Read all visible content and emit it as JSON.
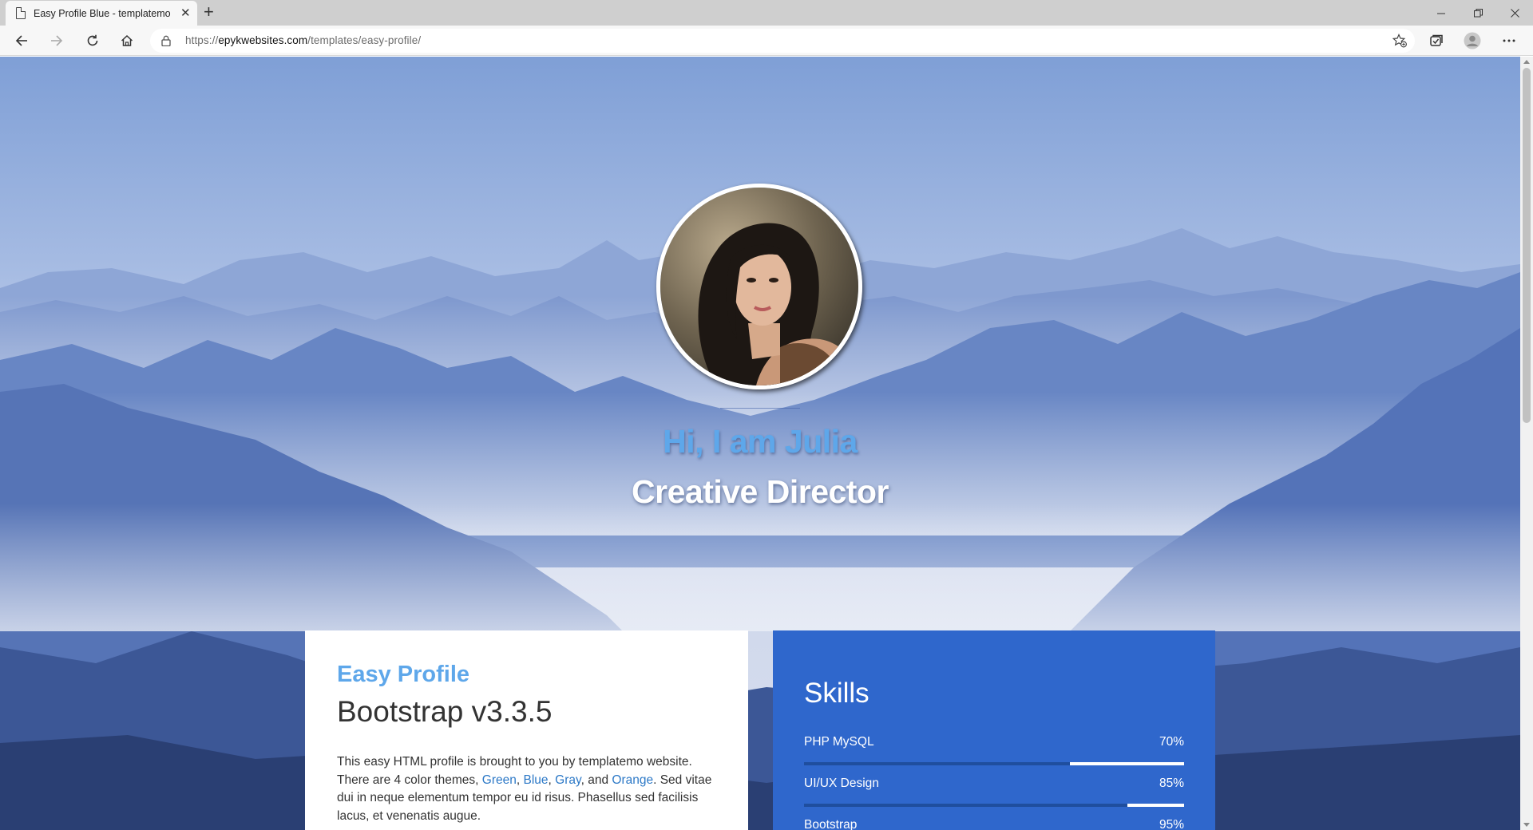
{
  "browser": {
    "tab_title": "Easy Profile Blue - templatemo",
    "url_prefix": "https://",
    "url_domain": "epykwebsites.com",
    "url_path": "/templates/easy-profile/"
  },
  "hero": {
    "greeting": "Hi, I am Julia",
    "role": "Creative Director"
  },
  "intro": {
    "eyebrow": "Easy Profile",
    "heading": "Bootstrap v3.3.5",
    "text_1": "This easy HTML profile is brought to you by templatemo website. There are 4 color themes, ",
    "link_green": "Green",
    "sep_1": ", ",
    "link_blue": "Blue",
    "sep_2": ", ",
    "link_gray": "Gray",
    "sep_3": ", and ",
    "link_orange": "Orange",
    "text_2": ". Sed vitae dui in neque elementum tempor eu id risus. Phasellus sed facilisis lacus, et venenatis augue."
  },
  "skills": {
    "heading": "Skills",
    "items": [
      {
        "name": "PHP MySQL",
        "percent_label": "70%",
        "percent": 70
      },
      {
        "name": "UI/UX Design",
        "percent_label": "85%",
        "percent": 85
      },
      {
        "name": "Bootstrap",
        "percent_label": "95%",
        "percent": 95
      }
    ]
  },
  "colors": {
    "accent": "#5ea7ea",
    "skills_bg": "#2f67cc",
    "link": "#2d79c7"
  }
}
